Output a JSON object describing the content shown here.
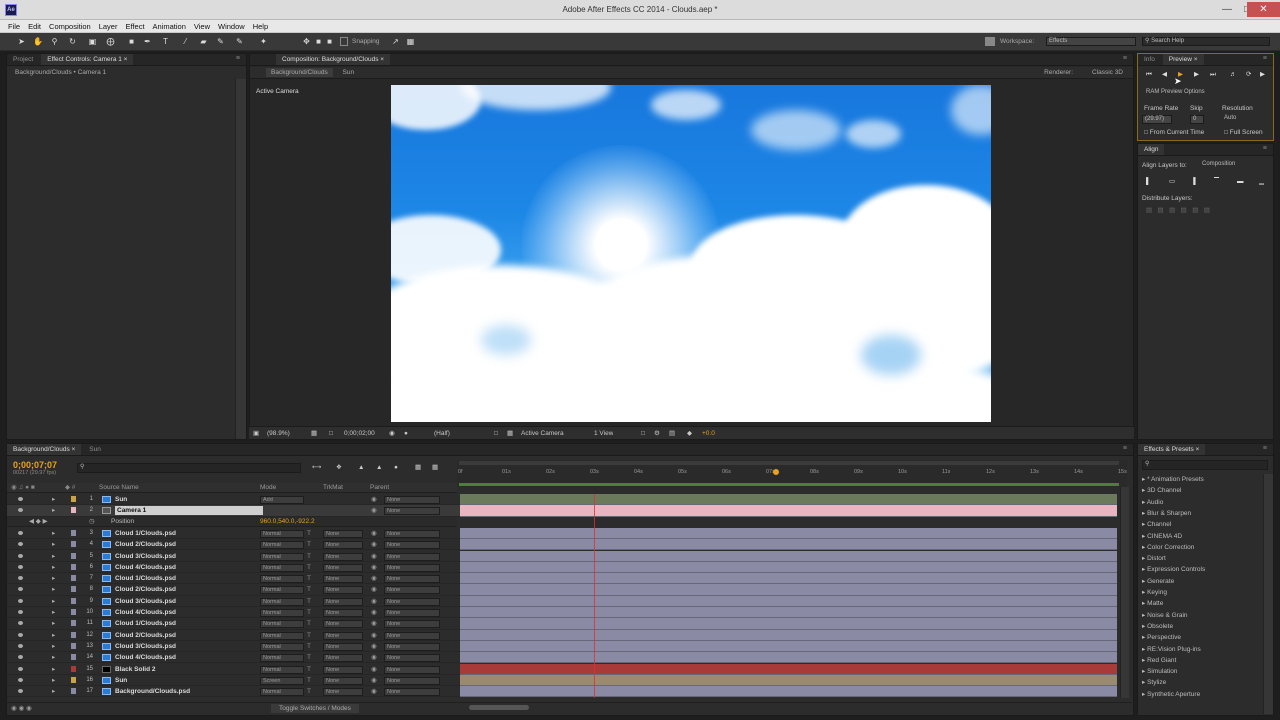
{
  "window": {
    "title": "Adobe After Effects CC 2014 - Clouds.aep *",
    "icon": "Ae"
  },
  "menu": [
    "File",
    "Edit",
    "Composition",
    "Layer",
    "Effect",
    "Animation",
    "View",
    "Window",
    "Help"
  ],
  "toolbar": {
    "snapping": "Snapping",
    "workspace_label": "Workspace:",
    "workspace_value": "Effects",
    "search_placeholder": "Search Help"
  },
  "project_panel": {
    "tab_project": "Project",
    "tab_effect_controls": "Effect Controls: Camera 1",
    "breadcrumb": "Background/Clouds • Camera 1"
  },
  "comp_panel": {
    "tab": "Composition: Background/Clouds",
    "subtab_active": "Background/Clouds",
    "subtab_other": "Sun",
    "renderer_label": "Renderer:",
    "renderer_value": "Classic 3D",
    "view_label": "Active Camera",
    "footer": {
      "zoom": "(98.9%)",
      "timecode": "0;00;02;00",
      "resolution": "(Half)",
      "view_mode": "Active Camera",
      "views": "1 View",
      "exposure": "+0.0"
    }
  },
  "preview_panel": {
    "tab_info": "Info",
    "tab_preview": "Preview",
    "ram_options": "RAM Preview Options",
    "frame_rate_label": "Frame Rate",
    "skip_label": "Skip",
    "resolution_label": "Resolution",
    "frame_rate_value": "(29.97)",
    "skip_value": "0",
    "resolution_value": "Auto",
    "from_current": "From Current Time",
    "full_screen": "Full Screen"
  },
  "align_panel": {
    "tab": "Align",
    "align_to_label": "Align Layers to:",
    "align_to_value": "Composition",
    "distribute_label": "Distribute Layers:"
  },
  "timeline": {
    "tab_main": "Background/Clouds",
    "tab_other": "Sun",
    "timecode": "0;00;07;07",
    "frames": "00217 (29.97 fps)",
    "search_placeholder": "",
    "headers": {
      "source_name": "Source Name",
      "mode": "Mode",
      "trkmat": "TrkMat",
      "parent": "Parent"
    },
    "ruler": [
      "0f",
      "01s",
      "02s",
      "03s",
      "04s",
      "05s",
      "06s",
      "07s",
      "08s",
      "09s",
      "10s",
      "11s",
      "12s",
      "13s",
      "14s",
      "15s"
    ],
    "position_label": "Position",
    "position_value": "960.0,540.0,-922.2",
    "toggle_label": "Toggle Switches / Modes",
    "layers": [
      {
        "num": "1",
        "name": "Sun",
        "mode": "Add",
        "trkmat": "",
        "parent": "None",
        "type": "precomp"
      },
      {
        "num": "2",
        "name": "Camera 1",
        "mode": "",
        "trkmat": "",
        "parent": "None",
        "type": "camera"
      },
      {
        "num": "3",
        "name": "Cloud 1/Clouds.psd",
        "mode": "Normal",
        "trkmat": "None",
        "parent": "None",
        "type": "footage"
      },
      {
        "num": "4",
        "name": "Cloud 2/Clouds.psd",
        "mode": "Normal",
        "trkmat": "None",
        "parent": "None",
        "type": "footage"
      },
      {
        "num": "5",
        "name": "Cloud 3/Clouds.psd",
        "mode": "Normal",
        "trkmat": "None",
        "parent": "None",
        "type": "footage"
      },
      {
        "num": "6",
        "name": "Cloud 4/Clouds.psd",
        "mode": "Normal",
        "trkmat": "None",
        "parent": "None",
        "type": "footage"
      },
      {
        "num": "7",
        "name": "Cloud 1/Clouds.psd",
        "mode": "Normal",
        "trkmat": "None",
        "parent": "None",
        "type": "footage"
      },
      {
        "num": "8",
        "name": "Cloud 2/Clouds.psd",
        "mode": "Normal",
        "trkmat": "None",
        "parent": "None",
        "type": "footage"
      },
      {
        "num": "9",
        "name": "Cloud 3/Clouds.psd",
        "mode": "Normal",
        "trkmat": "None",
        "parent": "None",
        "type": "footage"
      },
      {
        "num": "10",
        "name": "Cloud 4/Clouds.psd",
        "mode": "Normal",
        "trkmat": "None",
        "parent": "None",
        "type": "footage"
      },
      {
        "num": "11",
        "name": "Cloud 1/Clouds.psd",
        "mode": "Normal",
        "trkmat": "None",
        "parent": "None",
        "type": "footage"
      },
      {
        "num": "12",
        "name": "Cloud 2/Clouds.psd",
        "mode": "Normal",
        "trkmat": "None",
        "parent": "None",
        "type": "footage"
      },
      {
        "num": "13",
        "name": "Cloud 3/Clouds.psd",
        "mode": "Normal",
        "trkmat": "None",
        "parent": "None",
        "type": "footage"
      },
      {
        "num": "14",
        "name": "Cloud 4/Clouds.psd",
        "mode": "Normal",
        "trkmat": "None",
        "parent": "None",
        "type": "footage"
      },
      {
        "num": "15",
        "name": "Black Solid 2",
        "mode": "Normal",
        "trkmat": "None",
        "parent": "None",
        "type": "solid"
      },
      {
        "num": "16",
        "name": "Sun",
        "mode": "Screen",
        "trkmat": "None",
        "parent": "None",
        "type": "precomp"
      },
      {
        "num": "17",
        "name": "Background/Clouds.psd",
        "mode": "Normal",
        "trkmat": "None",
        "parent": "None",
        "type": "footage"
      }
    ]
  },
  "effects_panel": {
    "tab": "Effects & Presets",
    "items": [
      "* Animation Presets",
      "3D Channel",
      "Audio",
      "Blur & Sharpen",
      "Channel",
      "CINEMA 4D",
      "Color Correction",
      "Distort",
      "Expression Controls",
      "Generate",
      "Keying",
      "Matte",
      "Noise & Grain",
      "Obsolete",
      "Perspective",
      "RE:Vision Plug-ins",
      "Red Giant",
      "Simulation",
      "Stylize",
      "Synthetic Aperture"
    ]
  },
  "colors": {
    "bar_default": "#8a8aa4",
    "bar_camera": "#e8b5c0",
    "bar_solid": "#a83a3a",
    "bar_sun": "#9a8a70",
    "accent": "#e8a21c"
  }
}
